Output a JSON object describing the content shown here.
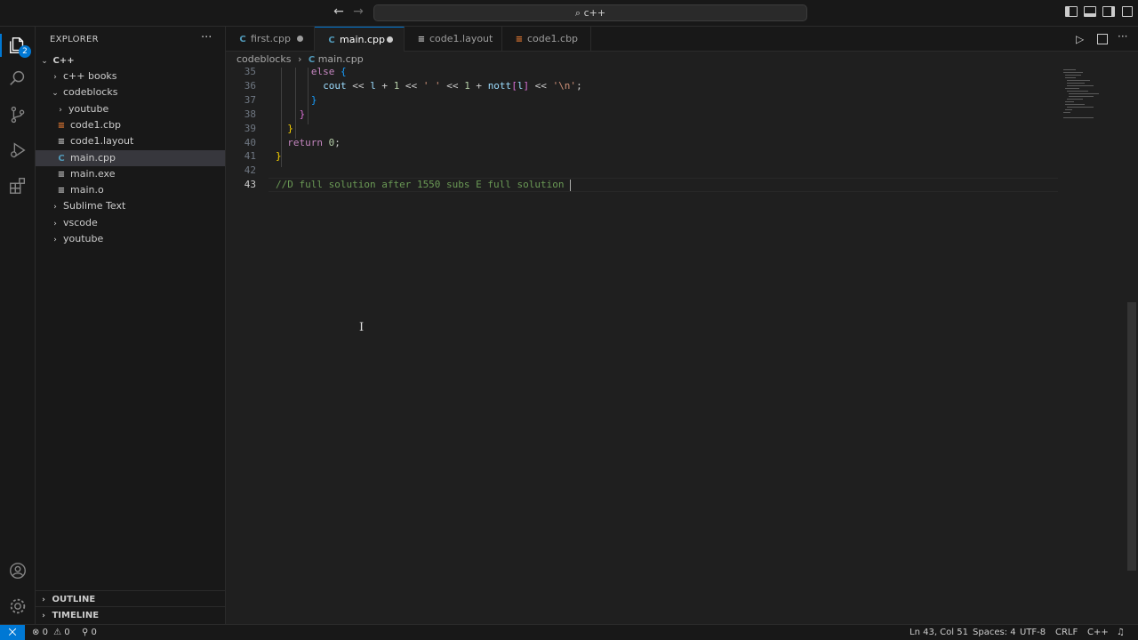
{
  "titlebar": {
    "back": "←",
    "forward": "→",
    "search_text": "⌕ c++"
  },
  "activity": {
    "explorer_badge": "2"
  },
  "sidebar": {
    "title": "EXPLORER",
    "more": "···",
    "root": "C++",
    "items": [
      {
        "label": "c++ books",
        "kind": "folder",
        "open": false,
        "depth": 1
      },
      {
        "label": "codeblocks",
        "kind": "folder",
        "open": true,
        "depth": 1
      },
      {
        "label": "youtube",
        "kind": "folder",
        "open": false,
        "depth": 2
      },
      {
        "label": "code1.cbp",
        "kind": "cbp",
        "depth": 2
      },
      {
        "label": "code1.layout",
        "kind": "text",
        "depth": 2
      },
      {
        "label": "main.cpp",
        "kind": "cpp",
        "depth": 2,
        "selected": true
      },
      {
        "label": "main.exe",
        "kind": "text",
        "depth": 2
      },
      {
        "label": "main.o",
        "kind": "text",
        "depth": 2
      },
      {
        "label": "Sublime Text",
        "kind": "folder",
        "open": false,
        "depth": 1
      },
      {
        "label": "vscode",
        "kind": "folder",
        "open": false,
        "depth": 1
      },
      {
        "label": "youtube",
        "kind": "folder",
        "open": false,
        "depth": 1
      }
    ],
    "outline": "OUTLINE",
    "timeline": "TIMELINE"
  },
  "tabs": [
    {
      "label": "first.cpp",
      "icon": "cpp",
      "dirty": true,
      "active": false
    },
    {
      "label": "main.cpp",
      "icon": "cpp",
      "dirty": true,
      "active": true
    },
    {
      "label": "code1.layout",
      "icon": "text",
      "dirty": false,
      "active": false
    },
    {
      "label": "code1.cbp",
      "icon": "cbp",
      "dirty": false,
      "active": false
    }
  ],
  "breadcrumb": {
    "folder": "codeblocks",
    "sep": "›",
    "file": "main.cpp"
  },
  "editor": {
    "lines": [
      {
        "n": "35",
        "code": "else {"
      },
      {
        "n": "36",
        "code": "cout << l + 1 << ' ' << 1 + nott[l] << '\\n';"
      },
      {
        "n": "37",
        "code": "}"
      },
      {
        "n": "38",
        "code": "}"
      },
      {
        "n": "39",
        "code": "}"
      },
      {
        "n": "40",
        "code": "return 0;"
      },
      {
        "n": "41",
        "code": "}"
      },
      {
        "n": "42",
        "code": ""
      },
      {
        "n": "43",
        "code": "//D full solution after 1550 subs E full solution "
      }
    ],
    "current_line": "43"
  },
  "status": {
    "remote": "⨉",
    "errors": "0",
    "warnings": "0",
    "ports": "0",
    "position": "Ln 43, Col 51",
    "spaces": "Spaces: 4",
    "encoding": "UTF-8",
    "eol": "CRLF",
    "language": "C++"
  },
  "colors": {
    "accent": "#0078d4",
    "background": "#1f1f1f",
    "sidebar": "#181818"
  }
}
